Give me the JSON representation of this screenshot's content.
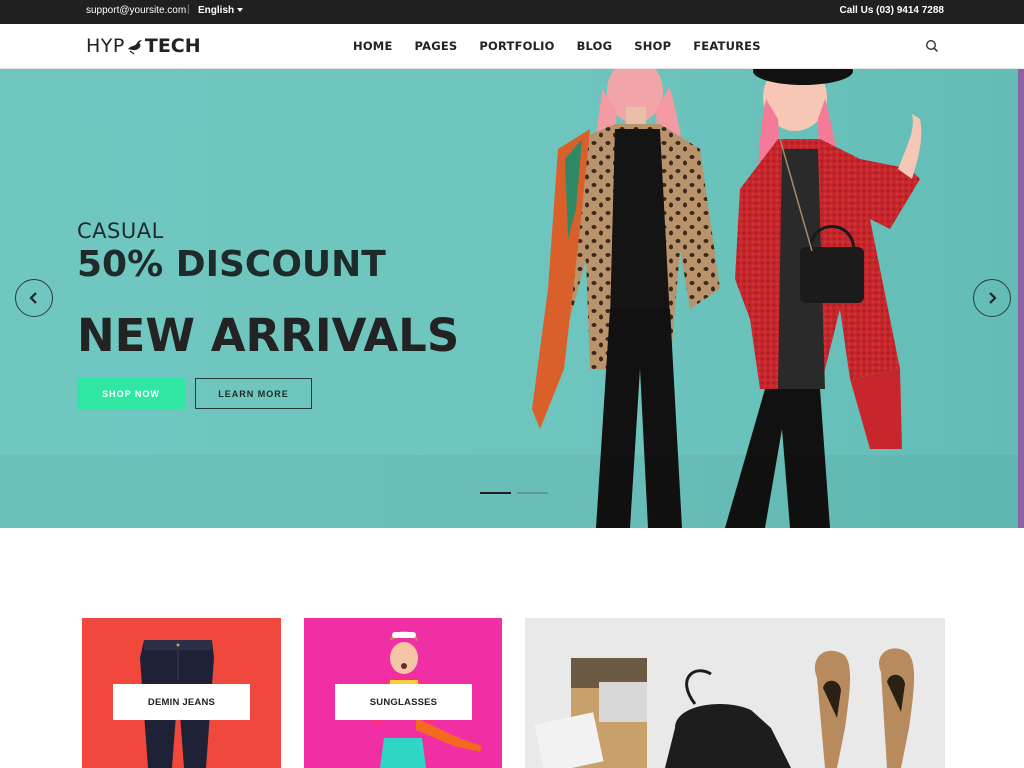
{
  "topbar": {
    "email": "support@yoursite.com",
    "separator": "|",
    "language": "English",
    "phone": "Call Us (03) 9414 7288"
  },
  "header": {
    "logo_left": "HYP",
    "logo_right": "TECH",
    "nav": [
      "HOME",
      "PAGES",
      "PORTFOLIO",
      "BLOG",
      "SHOP",
      "FEATURES"
    ]
  },
  "hero": {
    "subtitle": "CASUAL",
    "discount": "50% DISCOUNT",
    "headline": "NEW ARRIVALS",
    "primary_button": "SHOP NOW",
    "secondary_button": "LEARN MORE",
    "slide_count": 2,
    "active_slide": 1
  },
  "categories": [
    {
      "label": "DEMIN JEANS",
      "color": "#f0483c"
    },
    {
      "label": "SUNGLASSES",
      "color": "#f02fa5"
    },
    {
      "label": "",
      "color": "#e9e9e9"
    }
  ],
  "colors": {
    "accent": "#2fe7a3",
    "hero_bg": "#6ec5be",
    "topbar_bg": "#202020"
  },
  "icons": {
    "search": "search-icon",
    "prev": "chevron-left-icon",
    "next": "chevron-right-icon",
    "language_caret": "caret-down-icon"
  }
}
